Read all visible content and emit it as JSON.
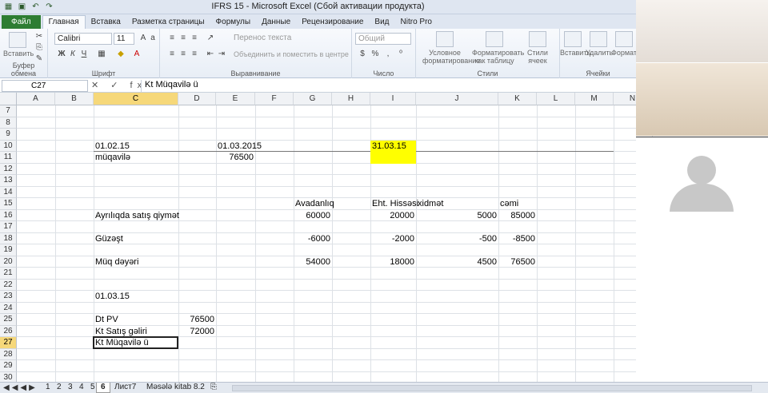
{
  "window": {
    "title": "IFRS 15 - Microsoft Excel (Сбой активации продукта)"
  },
  "ribbon_tabs": [
    "Файл",
    "Главная",
    "Вставка",
    "Разметка страницы",
    "Формулы",
    "Данные",
    "Рецензирование",
    "Вид",
    "Nitro Pro"
  ],
  "ribbon": {
    "paste_label": "Вставить",
    "font_name": "Calibri",
    "font_size": "11",
    "wrap_text": "Перенос текста",
    "merge_center": "Объединить и поместить в центре",
    "number_format": "Общий",
    "cond_format": "Условное форматирование",
    "format_table": "Форматировать как таблицу",
    "cell_styles": "Стили ячеек",
    "insert": "Вставить",
    "delete": "Удалить",
    "format": "Формат",
    "group_clipboard": "Буфер обмена",
    "group_font": "Шрифт",
    "group_alignment": "Выравнивание",
    "group_number": "Число",
    "group_styles": "Стили",
    "group_cells": "Ячейки"
  },
  "formula_bar": {
    "name_box": "C27",
    "formula": "Kt Müqavilə ü",
    "icons": "✕ ✓ fx"
  },
  "columns": [
    "A",
    "B",
    "C",
    "D",
    "E",
    "F",
    "G",
    "H",
    "I",
    "J",
    "K",
    "L",
    "M",
    "N"
  ],
  "rows": [
    "7",
    "8",
    "9",
    "10",
    "11",
    "12",
    "13",
    "14",
    "15",
    "16",
    "17",
    "18",
    "19",
    "20",
    "21",
    "22",
    "23",
    "24",
    "25",
    "26",
    "27",
    "28",
    "29",
    "30"
  ],
  "cells": {
    "C10": "01.02.15",
    "E10": "01.03.2015",
    "I10": "31.03.15",
    "C11": "müqavilə",
    "E11": "76500",
    "G15": "Avadanlıq",
    "I15": "Eht. Hissəsi",
    "J15": "xidmət",
    "K15": "cəmi",
    "C16": "Ayrılıqda satış qiymət",
    "G16": "60000",
    "I16": "20000",
    "J16": "5000",
    "K16": "85000",
    "C18": "Güzəşt",
    "G18": "-6000",
    "I18": "-2000",
    "J18": "-500",
    "K18": "-8500",
    "C20": "Müq dəyəri",
    "G20": "54000",
    "I20": "18000",
    "J20": "4500",
    "K20": "76500",
    "C23": "01.03.15",
    "C25": "Dt PV",
    "D25": "76500",
    "C26": "Kt Satış gəliri",
    "D26": "72000",
    "C27": "Kt Müqavilə ü"
  },
  "sheet_tabs": [
    "1",
    "2",
    "3",
    "4",
    "5",
    "6",
    "Лист7",
    "Məsələ kitab 8.2"
  ],
  "colors": {
    "highlight": "#ffff00",
    "file_tab": "#2e7d32"
  }
}
